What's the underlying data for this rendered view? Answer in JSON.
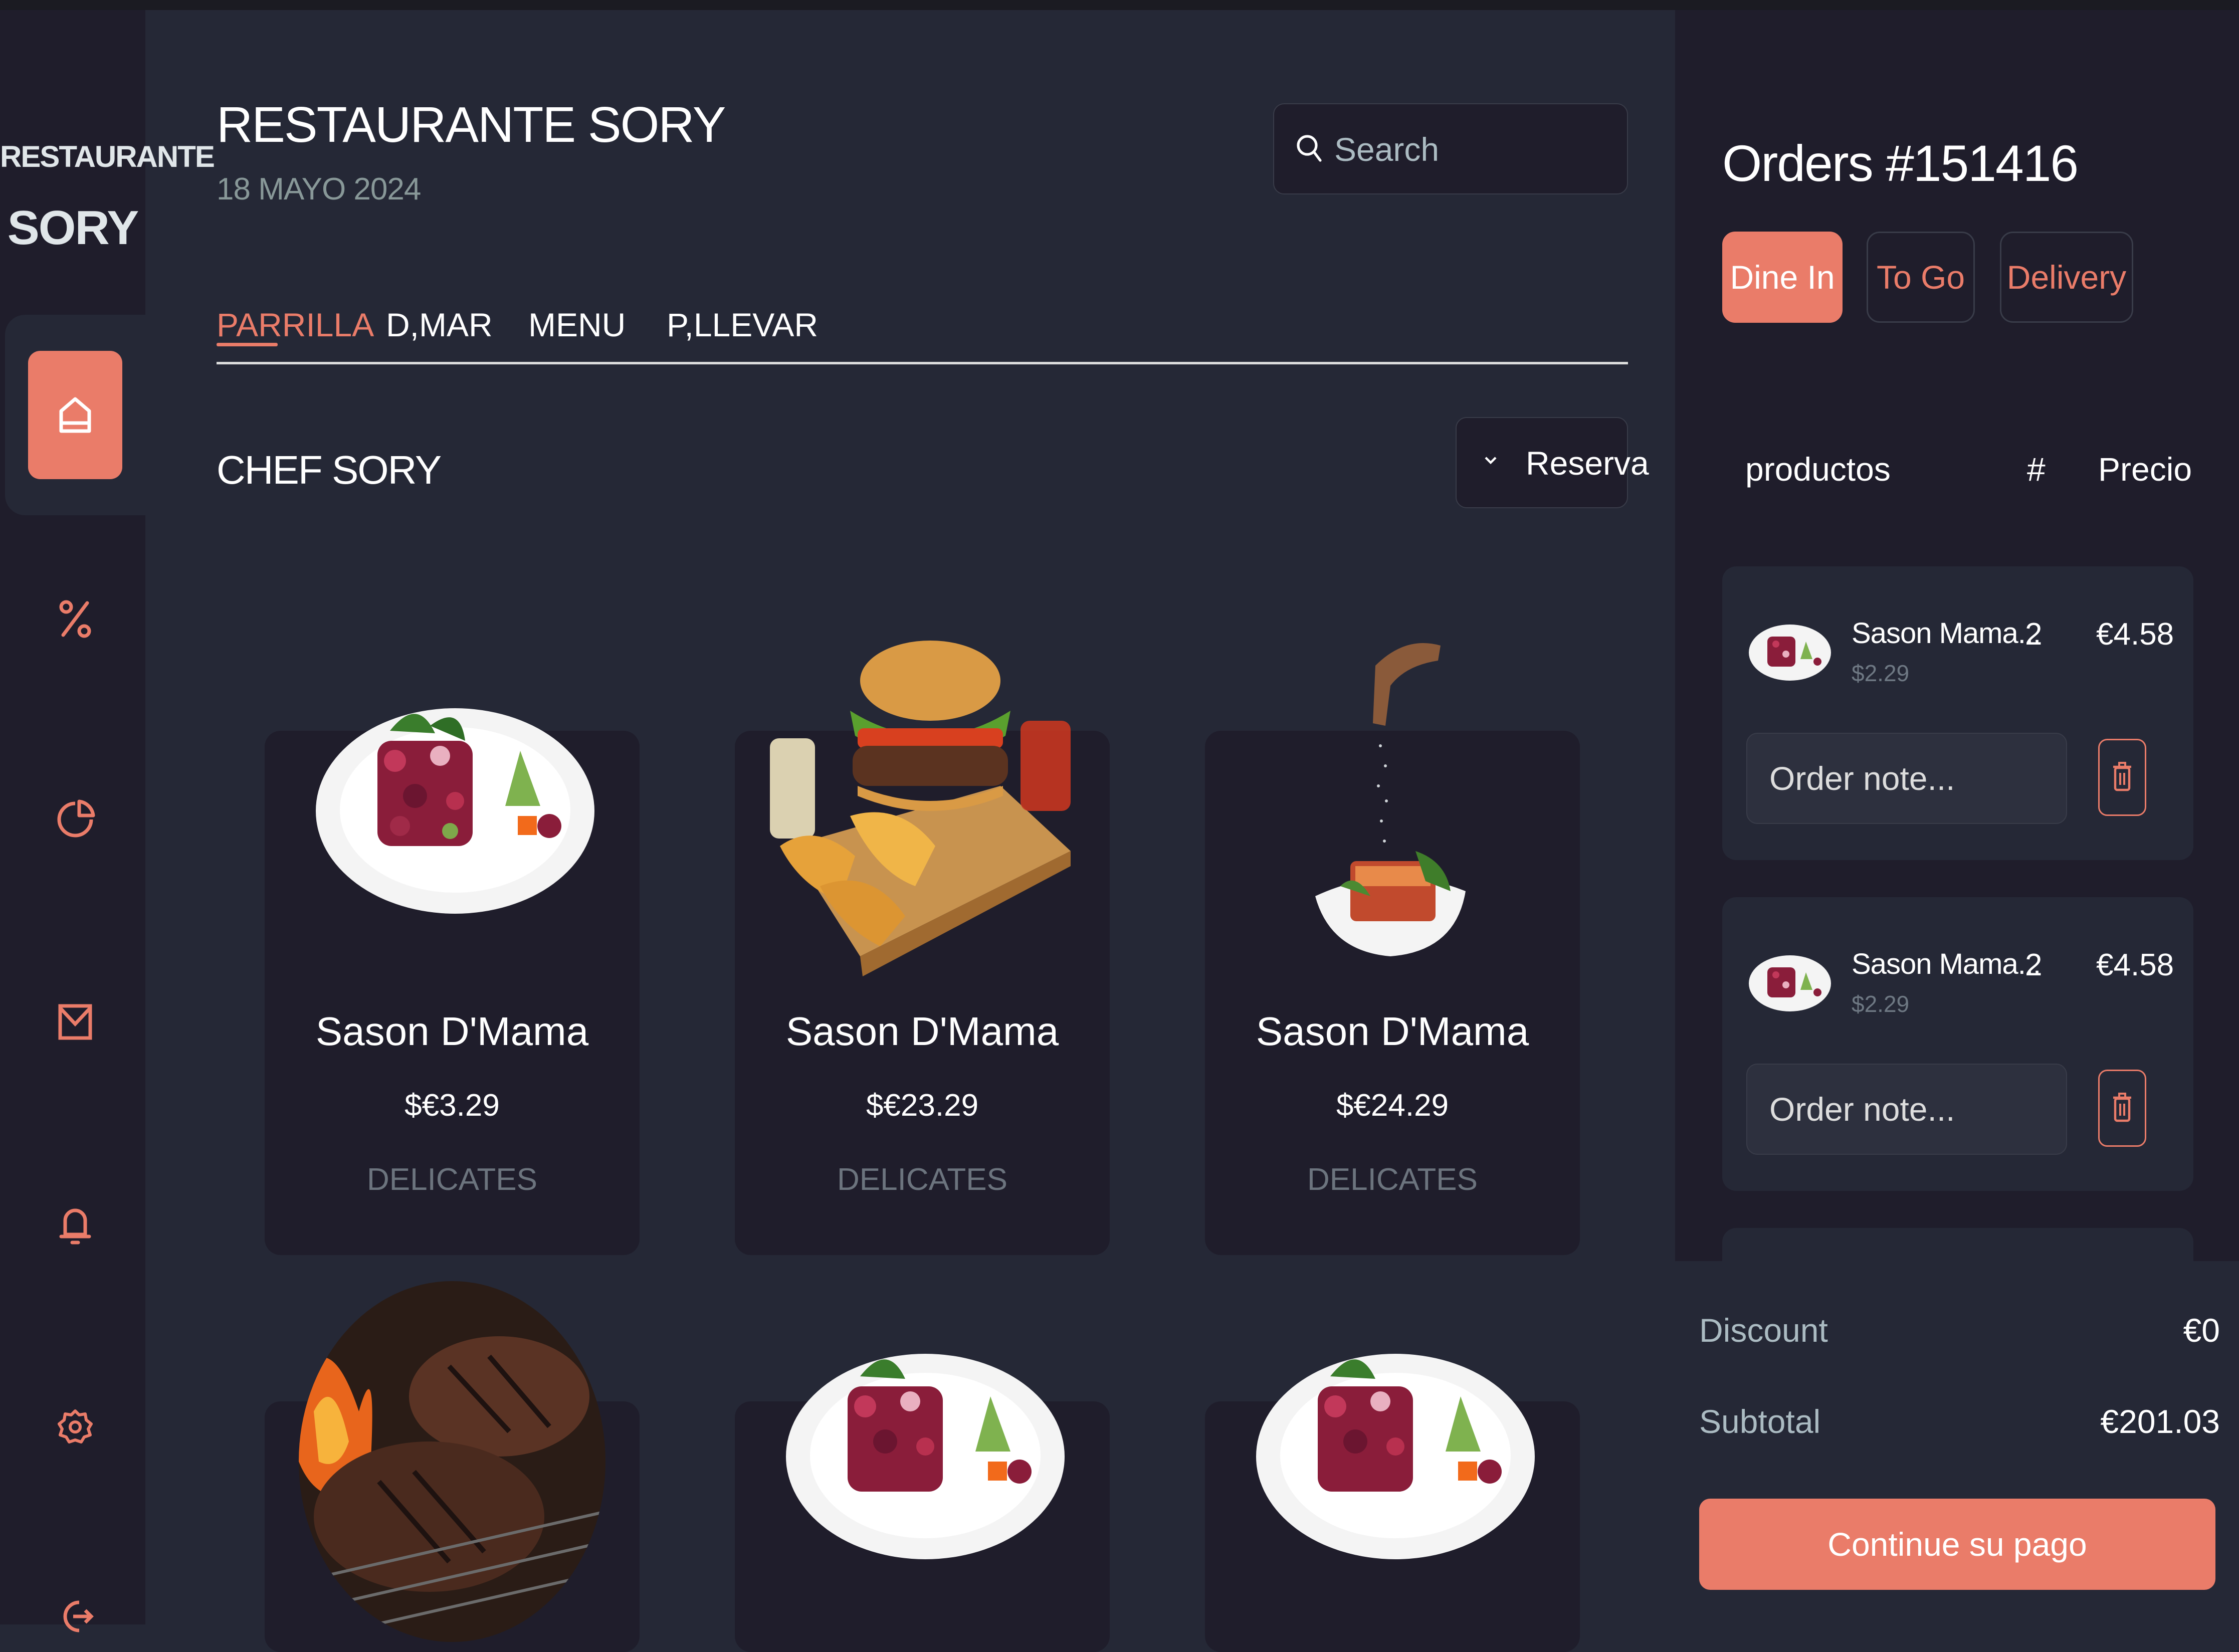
{
  "brand": {
    "line1": "RESTAURANTE",
    "line2": "SORY"
  },
  "sidebar": {
    "items": [
      {
        "icon": "home-icon",
        "active": true
      },
      {
        "icon": "discount-icon"
      },
      {
        "icon": "pie-chart-icon"
      },
      {
        "icon": "mail-icon"
      },
      {
        "icon": "bell-icon"
      },
      {
        "icon": "settings-icon"
      },
      {
        "icon": "logout-icon"
      }
    ]
  },
  "header": {
    "title": "RESTAURANTE SORY",
    "date": "18 MAYO 2024",
    "search_placeholder": "Search"
  },
  "tabs": [
    {
      "label": "PARRILLA",
      "active": true
    },
    {
      "label": "D,MAR"
    },
    {
      "label": "MENU"
    },
    {
      "label": "P,LLEVAR"
    }
  ],
  "section": {
    "title": "CHEF SORY",
    "dropdown_label": "Reserva"
  },
  "products": [
    {
      "name": "Sason D'Mama",
      "price": "$€3.29",
      "category": "DELICATES",
      "image": "salad-plate"
    },
    {
      "name": "Sason D'Mama",
      "price": "$€23.29",
      "category": "DELICATES",
      "image": "burger-fries"
    },
    {
      "name": "Sason D'Mama",
      "price": "$€24.29",
      "category": "DELICATES",
      "image": "lasagna-seasoning"
    },
    {
      "image": "grilled-steak"
    },
    {
      "image": "salad-plate"
    },
    {
      "image": "salad-plate"
    }
  ],
  "orders": {
    "title": "Orders #151416",
    "modes": [
      {
        "label": "Dine In",
        "active": true
      },
      {
        "label": "To Go"
      },
      {
        "label": "Delivery"
      }
    ],
    "columns": {
      "product": "productos",
      "qty": "#",
      "price": "Precio"
    },
    "items": [
      {
        "name": "Sason Mama...",
        "unit_price": "$2.29",
        "qty": "2",
        "total": "€4.58",
        "note_placeholder": "Order note..."
      },
      {
        "name": "Sason Mama...",
        "unit_price": "$2.29",
        "qty": "2",
        "total": "€4.58",
        "note_placeholder": "Order note..."
      }
    ],
    "summary": {
      "discount_label": "Discount",
      "discount_value": "€0",
      "subtotal_label": "Subtotal",
      "subtotal_value": "€201.03",
      "pay_label": "Continue su pago"
    }
  },
  "colors": {
    "accent": "#ea7c69",
    "background": "#252836",
    "panel": "#1f1d2b",
    "muted": "#abbbc2"
  }
}
